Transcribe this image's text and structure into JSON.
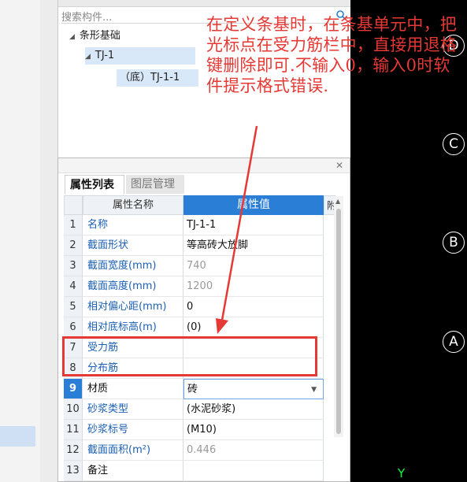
{
  "search": {
    "placeholder": "搜索构件..."
  },
  "tree": {
    "root": "条形基础",
    "child": "TJ-1",
    "leaf": "（底）TJ-1-1"
  },
  "prop_panel": {
    "tabs": [
      "属性列表",
      "图层管理"
    ],
    "columns": {
      "name": "属性名称",
      "value": "属性值",
      "extra": "附"
    },
    "rows": [
      {
        "n": "1",
        "name": "名称",
        "value": "TJ-1-1"
      },
      {
        "n": "2",
        "name": "截面形状",
        "value": "等高砖大放脚"
      },
      {
        "n": "3",
        "name": "截面宽度(mm)",
        "value": "740"
      },
      {
        "n": "4",
        "name": "截面高度(mm)",
        "value": "1200"
      },
      {
        "n": "5",
        "name": "相对偏心距(mm)",
        "value": "0"
      },
      {
        "n": "6",
        "name": "相对底标高(m)",
        "value": "(0)"
      },
      {
        "n": "7",
        "name": "受力筋",
        "value": ""
      },
      {
        "n": "8",
        "name": "分布筋",
        "value": ""
      },
      {
        "n": "9",
        "name": "材质",
        "value": "砖"
      },
      {
        "n": "10",
        "name": "砂浆类型",
        "value": "(水泥砂浆)"
      },
      {
        "n": "11",
        "name": "砂浆标号",
        "value": "(M10)"
      },
      {
        "n": "12",
        "name": "截面面积(m²)",
        "value": "0.446"
      },
      {
        "n": "13",
        "name": "备注",
        "value": ""
      }
    ]
  },
  "annotation": {
    "text": "在定义条基时，在条基单元中，把光标点在受力筋栏中，直接用退格键删除即可.不输入0，输入0时软件提示格式错误."
  },
  "axes": [
    "D",
    "C",
    "B",
    "A"
  ],
  "y_axis_label": "Y",
  "colors": {
    "accent": "#2b7ed6",
    "annotation": "#e53935",
    "canvas": "#000000",
    "y_axis": "#00ff3c"
  }
}
